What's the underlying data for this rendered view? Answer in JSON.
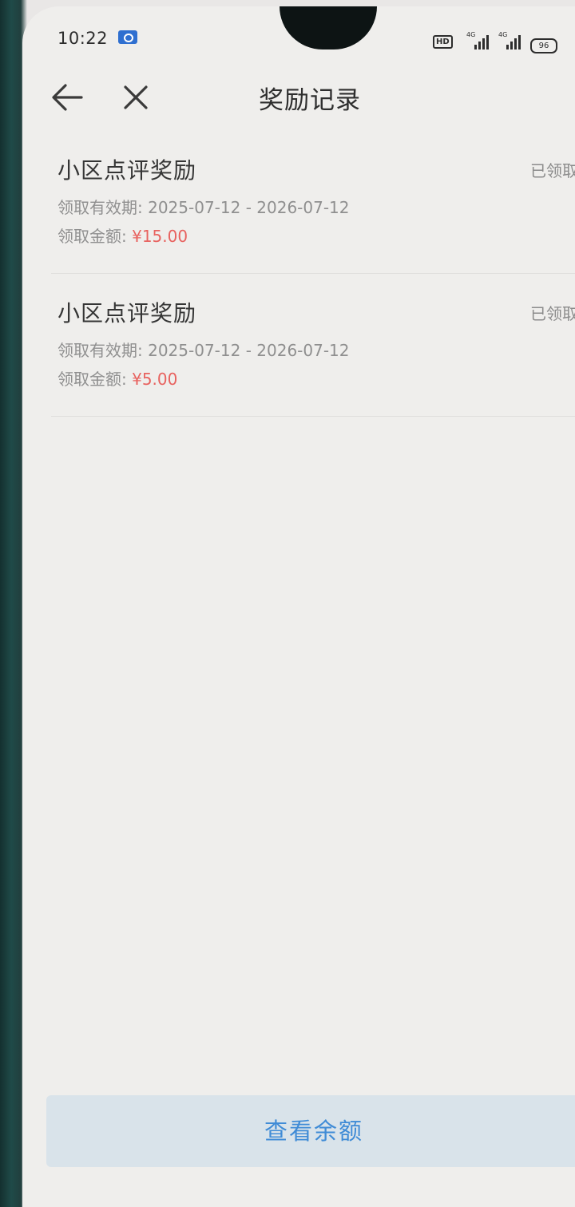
{
  "status_bar": {
    "time": "10:22",
    "hd_label": "HD",
    "signal_1_label": "4G",
    "signal_2_label": "4G",
    "battery_level": "96"
  },
  "nav": {
    "title": "奖励记录",
    "back_icon": "arrow-left-icon",
    "close_icon": "close-icon"
  },
  "records": [
    {
      "title": "小区点评奖励",
      "status": "已领取",
      "validity_label": "领取有效期:",
      "validity_value": "2025-07-12 - 2026-07-12",
      "amount_label": "领取金额:",
      "amount_value": "¥15.00"
    },
    {
      "title": "小区点评奖励",
      "status": "已领取",
      "validity_label": "领取有效期:",
      "validity_value": "2025-07-12 - 2026-07-12",
      "amount_label": "领取金额:",
      "amount_value": "¥5.00"
    }
  ],
  "footer": {
    "button_label": "查看余额"
  },
  "colors": {
    "amount": "#e8625f",
    "button_text": "#3f8bd6",
    "button_bg": "#d9e3ea"
  }
}
